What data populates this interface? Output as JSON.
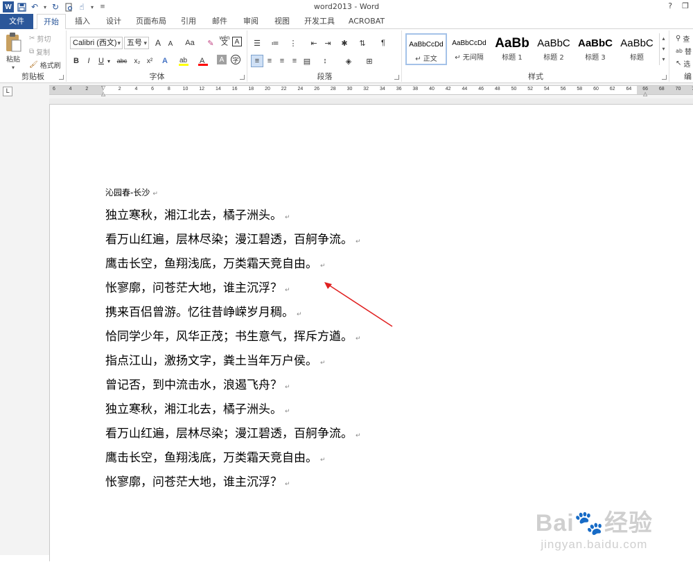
{
  "window": {
    "title": "word2013 - Word",
    "help": "?",
    "restore": "❐"
  },
  "qat": {
    "app_icon": "W"
  },
  "tabs": [
    "文件",
    "开始",
    "插入",
    "设计",
    "页面布局",
    "引用",
    "邮件",
    "审阅",
    "视图",
    "开发工具",
    "ACROBAT"
  ],
  "clipboard": {
    "label": "剪贴板",
    "paste": "粘贴",
    "cut": "剪切",
    "copy": "复制",
    "format_painter": "格式刷"
  },
  "font": {
    "label": "字体",
    "name": "Calibri (西文)",
    "size": "五号",
    "phonetic": "wén",
    "grow": "A",
    "shrink": "A",
    "case": "Aa"
  },
  "paragraph": {
    "label": "段落"
  },
  "styles": {
    "label": "样式",
    "items": [
      {
        "sample": "AaBbCcDd",
        "name": "↵ 正文"
      },
      {
        "sample": "AaBbCcDd",
        "name": "↵ 无间隔"
      },
      {
        "sample": "AaBb",
        "name": "标题 1"
      },
      {
        "sample": "AaBbC",
        "name": "标题 2"
      },
      {
        "sample": "AaBbC",
        "name": "标题 3"
      },
      {
        "sample": "AaBbC",
        "name": "标题"
      }
    ]
  },
  "editing": {
    "label": "编",
    "find": "查",
    "replace": "替",
    "select": "选"
  },
  "ruler": {
    "ticks": [
      "6",
      "4",
      "2",
      "",
      "2",
      "4",
      "6",
      "8",
      "10",
      "12",
      "14",
      "16",
      "18",
      "20",
      "22",
      "24",
      "26",
      "28",
      "30",
      "32",
      "34",
      "36",
      "38",
      "40",
      "42",
      "44",
      "46",
      "48",
      "50",
      "52",
      "54",
      "56",
      "58",
      "60",
      "62",
      "64",
      "66",
      "68",
      "70",
      "72"
    ],
    "corner": "L"
  },
  "document": {
    "title": "沁园春-长沙",
    "lines": [
      "独立寒秋，湘江北去，橘子洲头。",
      "看万山红遍，层林尽染；漫江碧透，百舸争流。",
      "鹰击长空，鱼翔浅底，万类霜天竞自由。",
      "怅寥廓，问苍茫大地，谁主沉浮？",
      "携来百侣曾游。忆往昔峥嵘岁月稠。",
      "恰同学少年，风华正茂；书生意气，挥斥方遒。",
      "指点江山，激扬文字，粪土当年万户侯。",
      "曾记否，到中流击水，浪遏飞舟？",
      "独立寒秋，湘江北去，橘子洲头。",
      "看万山红遍，层林尽染；漫江碧透，百舸争流。",
      "鹰击长空，鱼翔浅底，万类霜天竞自由。",
      "怅寥廓，问苍茫大地，谁主沉浮？"
    ],
    "paragraph_mark": "↵"
  },
  "watermark": {
    "main": "Bai🐾经验",
    "sub": "jingyan.baidu.com"
  },
  "colors": {
    "accent": "#2b579a",
    "arrow": "#e02020",
    "highlight": "#ffff00",
    "font_color": "#ff0000"
  }
}
